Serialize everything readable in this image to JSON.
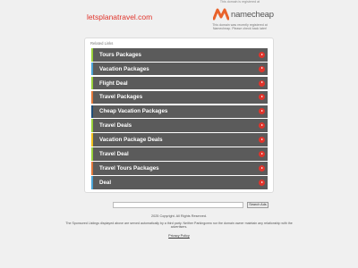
{
  "header": {
    "domain": "letsplanatravel.com",
    "registered_note": "This domain is registered at",
    "registrar_name": "namecheap",
    "registrar_note": "This domain was recently registered at Namecheap. Please check back later!"
  },
  "related": {
    "label": "Related Links",
    "items": [
      {
        "label": "Tours Packages",
        "color": "#9ad13b"
      },
      {
        "label": "Vacation Packages",
        "color": "#4aa5d8"
      },
      {
        "label": "Flight Deal",
        "color": "#9ad13b"
      },
      {
        "label": "Travel Packages",
        "color": "#e2783a"
      },
      {
        "label": "Cheap Vacation Packages",
        "color": "#1f4e79"
      },
      {
        "label": "Travel Deals",
        "color": "#9ad13b"
      },
      {
        "label": "Vacation Package Deals",
        "color": "#f2c31b"
      },
      {
        "label": "Travel Deal",
        "color": "#9ad13b"
      },
      {
        "label": "Travel Tours Packages",
        "color": "#e2783a"
      },
      {
        "label": "Deal",
        "color": "#4aa5d8"
      }
    ]
  },
  "search": {
    "placeholder": "",
    "button_label": "Search Ads"
  },
  "footer": {
    "copyright": "2025 Copyright. All Rights Reserved.",
    "disclaimer": "The Sponsored Listings displayed above are served automatically by a third party. Neither Parkingcrew nor the domain owner maintain any relationship with the advertisers.",
    "privacy_label": "Privacy Policy"
  },
  "colors": {
    "accent": "#e0342b",
    "bar_bg": "#5b5b5b",
    "registrar_orange": "#e8622b"
  }
}
